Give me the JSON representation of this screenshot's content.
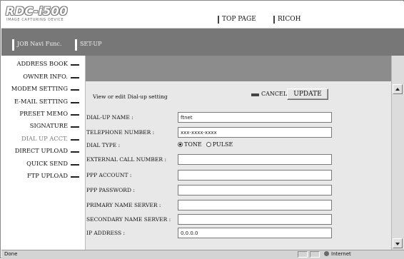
{
  "header": {
    "logo": "RDC-i500",
    "logo_sub": "IMAGE CAPTURING DEVICE",
    "links": [
      "TOP PAGE",
      "RICOH"
    ]
  },
  "nav": {
    "tabs": [
      "JOB Navi Func.",
      "SET-UP"
    ]
  },
  "sidebar": {
    "items": [
      {
        "label": "ADDRESS BOOK"
      },
      {
        "label": "OWNER INFO."
      },
      {
        "label": "MODEM SETTING"
      },
      {
        "label": "E-MAIL SETTING"
      },
      {
        "label": "PRESET MEMO"
      },
      {
        "label": "SIGNATURE"
      },
      {
        "label": "DIAL UP ACCT.",
        "active": true
      },
      {
        "label": "DIRECT UPLOAD"
      },
      {
        "label": "QUICK SEND"
      },
      {
        "label": "FTP UPLOAD"
      }
    ]
  },
  "form": {
    "heading": "View or edit Dial-up setting",
    "cancel_label": "CANCEL",
    "update_label": "UPDATE",
    "fields": {
      "dialup_name": {
        "label": "DIAL-UP NAME :",
        "value": "ftnet"
      },
      "telephone": {
        "label": "TELEPHONE NUMBER :",
        "value": "xxx-xxxx-xxxx"
      },
      "dial_type": {
        "label": "DIAL TYPE :",
        "options": [
          "TONE",
          "PULSE"
        ],
        "selected": "TONE"
      },
      "external_call": {
        "label": "EXTERNAL CALL NUMBER :",
        "value": ""
      },
      "ppp_account": {
        "label": "PPP ACCOUNT :",
        "value": ""
      },
      "ppp_password": {
        "label": "PPP PASSWORD :",
        "value": ""
      },
      "primary_ns": {
        "label": "PRIMARY NAME SERVER :",
        "value": ""
      },
      "secondary_ns": {
        "label": "SECONDARY NAME SERVER :",
        "value": ""
      },
      "ip_address": {
        "label": "IP ADDRESS :",
        "value": "0.0.0.0"
      }
    }
  },
  "statusbar": {
    "status": "Done",
    "zone": "Internet"
  },
  "colors": {
    "navbar": "#777777",
    "content_header": "#8c8c8c",
    "content_bg": "#e8e8e8"
  }
}
